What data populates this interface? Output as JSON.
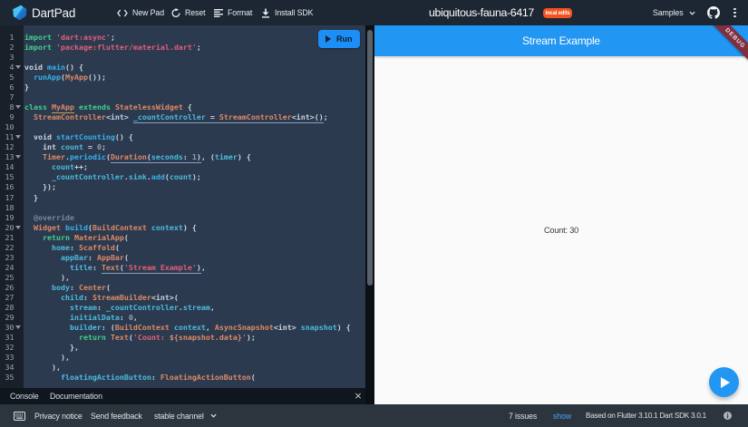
{
  "header": {
    "brand": "DartPad",
    "nav": [
      {
        "label": "New Pad",
        "icon": "code-icon"
      },
      {
        "label": "Reset",
        "icon": "refresh-icon"
      },
      {
        "label": "Format",
        "icon": "format-icon"
      },
      {
        "label": "Install SDK",
        "icon": "download-icon"
      }
    ],
    "pad_title": "ubiquitous-fauna-6417",
    "badge": "local edits",
    "samples_label": "Samples"
  },
  "editor": {
    "run_label": "Run",
    "lines": [
      {
        "n": 1,
        "fold": false,
        "tokens": [
          [
            "kw",
            "import"
          ],
          [
            "p",
            " "
          ],
          [
            "st",
            "'dart:async'"
          ],
          [
            "p",
            ";"
          ]
        ]
      },
      {
        "n": 2,
        "fold": false,
        "tokens": [
          [
            "kw",
            "import"
          ],
          [
            "p",
            " "
          ],
          [
            "st",
            "'package:flutter/material.dart'"
          ],
          [
            "p",
            ";"
          ]
        ]
      },
      {
        "n": 3,
        "fold": false,
        "tokens": []
      },
      {
        "n": 4,
        "fold": true,
        "tokens": [
          [
            "p",
            "void "
          ],
          [
            "fn",
            "main"
          ],
          [
            "p",
            "() {"
          ]
        ]
      },
      {
        "n": 5,
        "fold": false,
        "tokens": [
          [
            "p",
            "  "
          ],
          [
            "fn",
            "runApp"
          ],
          [
            "p",
            "("
          ],
          [
            "ty",
            "MyApp"
          ],
          [
            "p",
            "());"
          ]
        ]
      },
      {
        "n": 6,
        "fold": false,
        "tokens": [
          [
            "p",
            "}"
          ]
        ]
      },
      {
        "n": 7,
        "fold": false,
        "tokens": []
      },
      {
        "n": 8,
        "fold": true,
        "tokens": [
          [
            "kw",
            "class"
          ],
          [
            "p",
            " "
          ],
          [
            "ty",
            "MyApp",
            "w"
          ],
          [
            "p",
            " "
          ],
          [
            "kw",
            "extends"
          ],
          [
            "p",
            " "
          ],
          [
            "ty",
            "StatelessWidget"
          ],
          [
            "p",
            " {"
          ]
        ]
      },
      {
        "n": 9,
        "fold": false,
        "tokens": [
          [
            "p",
            "  "
          ],
          [
            "ty",
            "StreamController"
          ],
          [
            "p",
            "<int> "
          ],
          [
            "cy",
            "_countController",
            "i"
          ],
          [
            "p",
            " = ",
            "i"
          ],
          [
            "ty",
            "StreamController",
            "i"
          ],
          [
            "p",
            "<int>()",
            "i"
          ],
          [
            "p",
            ";"
          ]
        ]
      },
      {
        "n": 10,
        "fold": false,
        "tokens": []
      },
      {
        "n": 11,
        "fold": true,
        "tokens": [
          [
            "p",
            "  void "
          ],
          [
            "fn",
            "startCounting"
          ],
          [
            "p",
            "() {"
          ]
        ]
      },
      {
        "n": 12,
        "fold": false,
        "tokens": [
          [
            "p",
            "    int "
          ],
          [
            "cy",
            "count"
          ],
          [
            "p",
            " = "
          ],
          [
            "nm",
            "0"
          ],
          [
            "p",
            ";"
          ]
        ]
      },
      {
        "n": 13,
        "fold": true,
        "tokens": [
          [
            "p",
            "    "
          ],
          [
            "ty",
            "Timer"
          ],
          [
            "p",
            "."
          ],
          [
            "fn",
            "periodic"
          ],
          [
            "p",
            "("
          ],
          [
            "ty",
            "Duration",
            "i"
          ],
          [
            "p",
            "(",
            "i"
          ],
          [
            "cy",
            "seconds",
            "i"
          ],
          [
            "p",
            ": ",
            "i"
          ],
          [
            "nm",
            "1",
            "i"
          ],
          [
            "p",
            ")",
            "i"
          ],
          [
            "p",
            ", ("
          ],
          [
            "cy",
            "timer"
          ],
          [
            "p",
            ") {"
          ]
        ]
      },
      {
        "n": 14,
        "fold": false,
        "tokens": [
          [
            "p",
            "      "
          ],
          [
            "cy",
            "count"
          ],
          [
            "p",
            "++;"
          ]
        ]
      },
      {
        "n": 15,
        "fold": false,
        "tokens": [
          [
            "p",
            "      "
          ],
          [
            "cy",
            "_countController"
          ],
          [
            "p",
            "."
          ],
          [
            "cy",
            "sink"
          ],
          [
            "p",
            "."
          ],
          [
            "fn",
            "add"
          ],
          [
            "p",
            "("
          ],
          [
            "cy",
            "count"
          ],
          [
            "p",
            ");"
          ]
        ]
      },
      {
        "n": 16,
        "fold": false,
        "tokens": [
          [
            "p",
            "    });"
          ]
        ]
      },
      {
        "n": 17,
        "fold": false,
        "tokens": [
          [
            "p",
            "  }"
          ]
        ]
      },
      {
        "n": 18,
        "fold": false,
        "tokens": []
      },
      {
        "n": 19,
        "fold": false,
        "tokens": [
          [
            "gr",
            "  @override"
          ]
        ]
      },
      {
        "n": 20,
        "fold": true,
        "tokens": [
          [
            "p",
            "  "
          ],
          [
            "ty",
            "Widget"
          ],
          [
            "p",
            " "
          ],
          [
            "fn",
            "build"
          ],
          [
            "p",
            "("
          ],
          [
            "ty",
            "BuildContext"
          ],
          [
            "p",
            " "
          ],
          [
            "cy",
            "context"
          ],
          [
            "p",
            ") {"
          ]
        ]
      },
      {
        "n": 21,
        "fold": false,
        "tokens": [
          [
            "p",
            "    "
          ],
          [
            "kw",
            "return"
          ],
          [
            "p",
            " "
          ],
          [
            "ty",
            "MaterialApp"
          ],
          [
            "p",
            "("
          ]
        ]
      },
      {
        "n": 22,
        "fold": false,
        "tokens": [
          [
            "p",
            "      "
          ],
          [
            "cy",
            "home"
          ],
          [
            "p",
            ": "
          ],
          [
            "ty",
            "Scaffold"
          ],
          [
            "p",
            "("
          ]
        ]
      },
      {
        "n": 23,
        "fold": false,
        "tokens": [
          [
            "p",
            "        "
          ],
          [
            "cy",
            "appBar"
          ],
          [
            "p",
            ": "
          ],
          [
            "ty",
            "AppBar"
          ],
          [
            "p",
            "("
          ]
        ]
      },
      {
        "n": 24,
        "fold": false,
        "tokens": [
          [
            "p",
            "          "
          ],
          [
            "cy",
            "title"
          ],
          [
            "p",
            ": "
          ],
          [
            "ty",
            "Text",
            "i"
          ],
          [
            "p",
            "(",
            "i"
          ],
          [
            "st",
            "'Stream Example'",
            "i"
          ],
          [
            "p",
            ")",
            "i"
          ],
          [
            "p",
            ","
          ]
        ]
      },
      {
        "n": 25,
        "fold": false,
        "tokens": [
          [
            "p",
            "        ),"
          ]
        ]
      },
      {
        "n": 26,
        "fold": false,
        "tokens": [
          [
            "p",
            "      "
          ],
          [
            "cy",
            "body"
          ],
          [
            "p",
            ": "
          ],
          [
            "ty",
            "Center"
          ],
          [
            "p",
            "("
          ]
        ]
      },
      {
        "n": 27,
        "fold": false,
        "tokens": [
          [
            "p",
            "        "
          ],
          [
            "cy",
            "child"
          ],
          [
            "p",
            ": "
          ],
          [
            "ty",
            "StreamBuilder"
          ],
          [
            "p",
            "<int>("
          ]
        ]
      },
      {
        "n": 28,
        "fold": false,
        "tokens": [
          [
            "p",
            "          "
          ],
          [
            "cy",
            "stream"
          ],
          [
            "p",
            ": "
          ],
          [
            "cy",
            "_countController"
          ],
          [
            "p",
            "."
          ],
          [
            "cy",
            "stream"
          ],
          [
            "p",
            ","
          ]
        ]
      },
      {
        "n": 29,
        "fold": false,
        "tokens": [
          [
            "p",
            "          "
          ],
          [
            "cy",
            "initialData"
          ],
          [
            "p",
            ": "
          ],
          [
            "nm",
            "0"
          ],
          [
            "p",
            ","
          ]
        ]
      },
      {
        "n": 30,
        "fold": true,
        "tokens": [
          [
            "p",
            "          "
          ],
          [
            "cy",
            "builder"
          ],
          [
            "p",
            ": ("
          ],
          [
            "ty",
            "BuildContext"
          ],
          [
            "p",
            " "
          ],
          [
            "cy",
            "context"
          ],
          [
            "p",
            ", "
          ],
          [
            "ty",
            "AsyncSnapshot"
          ],
          [
            "p",
            "<int> "
          ],
          [
            "cy",
            "snapshot"
          ],
          [
            "p",
            ") {"
          ]
        ]
      },
      {
        "n": 31,
        "fold": false,
        "tokens": [
          [
            "p",
            "            "
          ],
          [
            "kw",
            "return"
          ],
          [
            "p",
            " "
          ],
          [
            "ty",
            "Text"
          ],
          [
            "p",
            "("
          ],
          [
            "st",
            "'Count: "
          ],
          [
            "ty",
            "${snapshot.data}"
          ],
          [
            "st",
            "'"
          ],
          [
            "p",
            ");"
          ]
        ]
      },
      {
        "n": 32,
        "fold": false,
        "tokens": [
          [
            "p",
            "          },"
          ]
        ]
      },
      {
        "n": 33,
        "fold": false,
        "tokens": [
          [
            "p",
            "        ),"
          ]
        ]
      },
      {
        "n": 34,
        "fold": false,
        "tokens": [
          [
            "p",
            "      ),"
          ]
        ]
      },
      {
        "n": 35,
        "fold": false,
        "tokens": [
          [
            "p",
            "        "
          ],
          [
            "cy",
            "floatingActionButton"
          ],
          [
            "p",
            ": "
          ],
          [
            "ty",
            "FloatingActionButton"
          ],
          [
            "p",
            "("
          ]
        ]
      }
    ]
  },
  "console": {
    "tabs": [
      {
        "label": "Console"
      },
      {
        "label": "Documentation"
      }
    ],
    "close_label": "×"
  },
  "preview": {
    "appbar_title": "Stream Example",
    "count_text": "Count: 30",
    "debug_label": "DEBUG"
  },
  "footer": {
    "privacy": "Privacy notice",
    "feedback": "Send feedback",
    "channel": "stable channel",
    "issues": "7 issues",
    "show": "show",
    "based_on": "Based on Flutter 3.10.1 Dart SDK 3.0.1"
  },
  "icons": {
    "logo": "dartpad-logo-icon",
    "new_pad": "code-icon",
    "reset": "refresh-icon",
    "format": "format-icon",
    "install": "download-icon",
    "samples_chevron": "chevron-down-icon",
    "github": "github-icon",
    "overflow": "overflow-menu-icon",
    "run": "play-icon",
    "fold": "fold-arrow-icon",
    "console_close": "close-icon",
    "fab": "fab-play-icon",
    "keyboard": "keyboard-icon",
    "channel_chevron": "chevron-down-icon",
    "info": "info-circle-icon"
  },
  "colors": {
    "accent_blue": "#2196f3",
    "badge_orange": "#ee5126",
    "debug_maroon": "#7e3040",
    "editor_bg": "#2b3a4f"
  }
}
